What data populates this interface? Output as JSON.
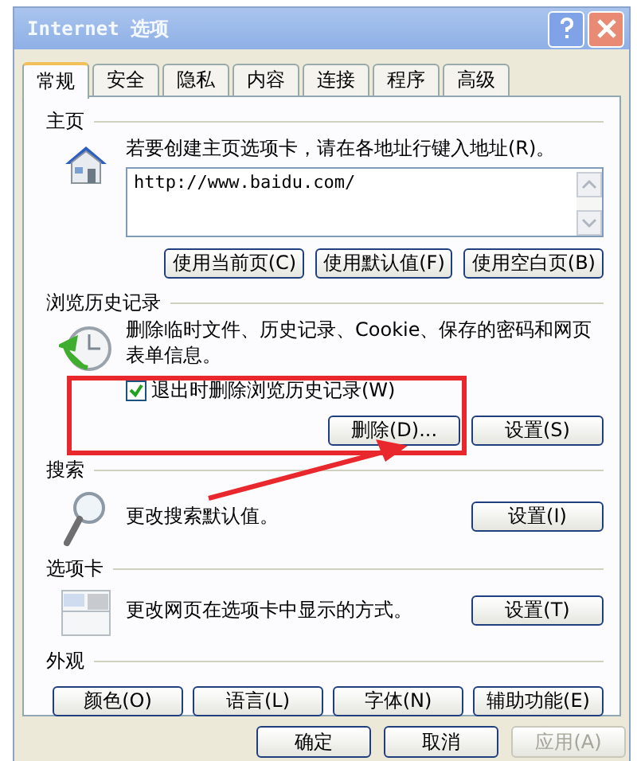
{
  "window": {
    "title": "Internet 选项"
  },
  "tabs": [
    {
      "label": "常规",
      "selected": true
    },
    {
      "label": "安全",
      "selected": false
    },
    {
      "label": "隐私",
      "selected": false
    },
    {
      "label": "内容",
      "selected": false
    },
    {
      "label": "连接",
      "selected": false
    },
    {
      "label": "程序",
      "selected": false
    },
    {
      "label": "高级",
      "selected": false
    }
  ],
  "sections": [
    {
      "kind": "homepage",
      "title": "主页",
      "description": "若要创建主页选项卡，请在各地址行键入地址(R)。",
      "url": "http://www.baidu.com/",
      "buttons": [
        "使用当前页(C)",
        "使用默认值(F)",
        "使用空白页(B)"
      ]
    },
    {
      "kind": "history",
      "title": "浏览历史记录",
      "description": "删除临时文件、历史记录、Cookie、保存的密码和网页表单信息。",
      "checkbox": {
        "label": "退出时删除浏览历史记录(W)",
        "checked": true
      },
      "buttons": [
        "删除(D)...",
        "设置(S)"
      ]
    },
    {
      "kind": "search",
      "title": "搜索",
      "description": "更改搜索默认值。",
      "buttons": [
        "设置(I)"
      ]
    },
    {
      "kind": "tabs",
      "title": "选项卡",
      "description": "更改网页在选项卡中显示的方式。",
      "buttons": [
        "设置(T)"
      ]
    },
    {
      "kind": "appearance",
      "title": "外观",
      "buttons": [
        "颜色(O)",
        "语言(L)",
        "字体(N)",
        "辅助功能(E)"
      ]
    }
  ],
  "footer_buttons": [
    {
      "label": "确定",
      "disabled": false
    },
    {
      "label": "取消",
      "disabled": false
    },
    {
      "label": "应用(A)",
      "disabled": true
    }
  ]
}
